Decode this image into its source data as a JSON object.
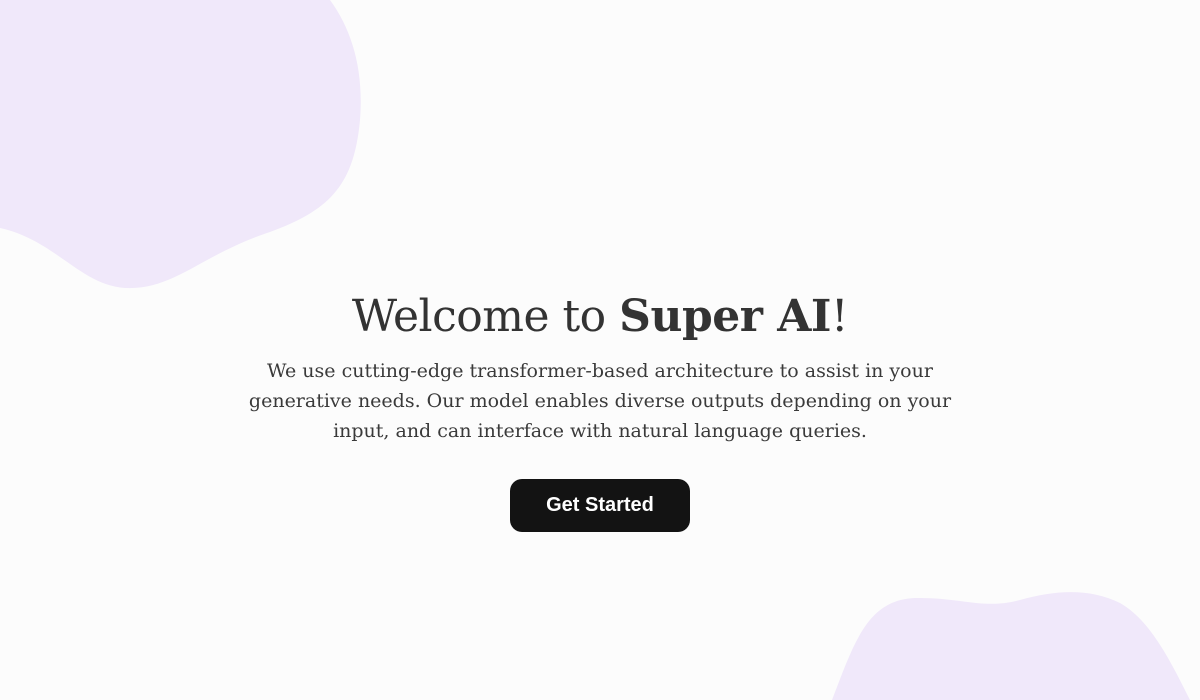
{
  "hero": {
    "title_prefix": "Welcome to ",
    "title_brand": "Super AI",
    "title_suffix": "!",
    "description": "We use cutting-edge transformer-based architecture to assist in your generative needs. Our model enables diverse outputs depending on your input, and can interface with natural language queries.",
    "cta_label": "Get Started"
  },
  "colors": {
    "background": "#fcfcfc",
    "blob": "#f0e8fa",
    "button": "#131313",
    "text": "#333333"
  }
}
